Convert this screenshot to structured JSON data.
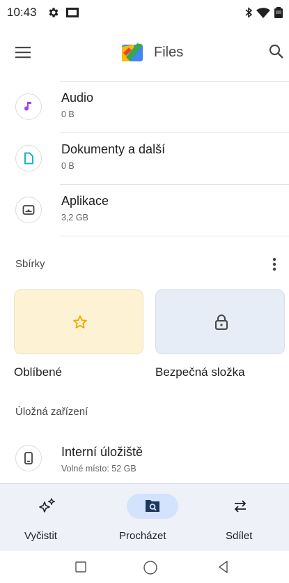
{
  "status_bar": {
    "time": "10:43",
    "icons": [
      "gear-icon",
      "screen-icon",
      "bluetooth-icon",
      "wifi-icon",
      "battery-icon"
    ]
  },
  "app_bar": {
    "title": "Files",
    "icons": [
      "menu-icon",
      "files-logo-icon",
      "search-icon"
    ]
  },
  "categories": [
    {
      "title": "Audio",
      "size": "0 B",
      "icon": "music-note-icon",
      "color": "#a142f4"
    },
    {
      "title": "Dokumenty a další",
      "size": "0 B",
      "icon": "document-icon",
      "color": "#12b5cb"
    },
    {
      "title": "Aplikace",
      "size": "3,2 GB",
      "icon": "android-icon",
      "color": "#3c4043"
    }
  ],
  "collections": {
    "label": "Sbírky",
    "cards": [
      {
        "label": "Oblíbené",
        "icon": "star-icon",
        "bg": "#fdf3d4",
        "icon_color": "#f2a600"
      },
      {
        "label": "Bezpečná složka",
        "icon": "lock-icon",
        "bg": "#e6edf7",
        "icon_color": "#444746"
      }
    ]
  },
  "storage": {
    "label": "Úložná zařízení",
    "devices": [
      {
        "title": "Interní úložiště",
        "subtitle": "Volné místo: 52 GB",
        "icon": "phone-icon"
      }
    ]
  },
  "bottom_nav": {
    "items": [
      {
        "label": "Vyčistit",
        "icon": "sparkle-icon",
        "active": false
      },
      {
        "label": "Procházet",
        "icon": "browse-icon",
        "active": true
      },
      {
        "label": "Sdílet",
        "icon": "swap-icon",
        "active": false
      }
    ],
    "active_pill_color": "#d3e3fd"
  },
  "system_nav": [
    "recents-icon",
    "home-icon",
    "back-icon"
  ]
}
